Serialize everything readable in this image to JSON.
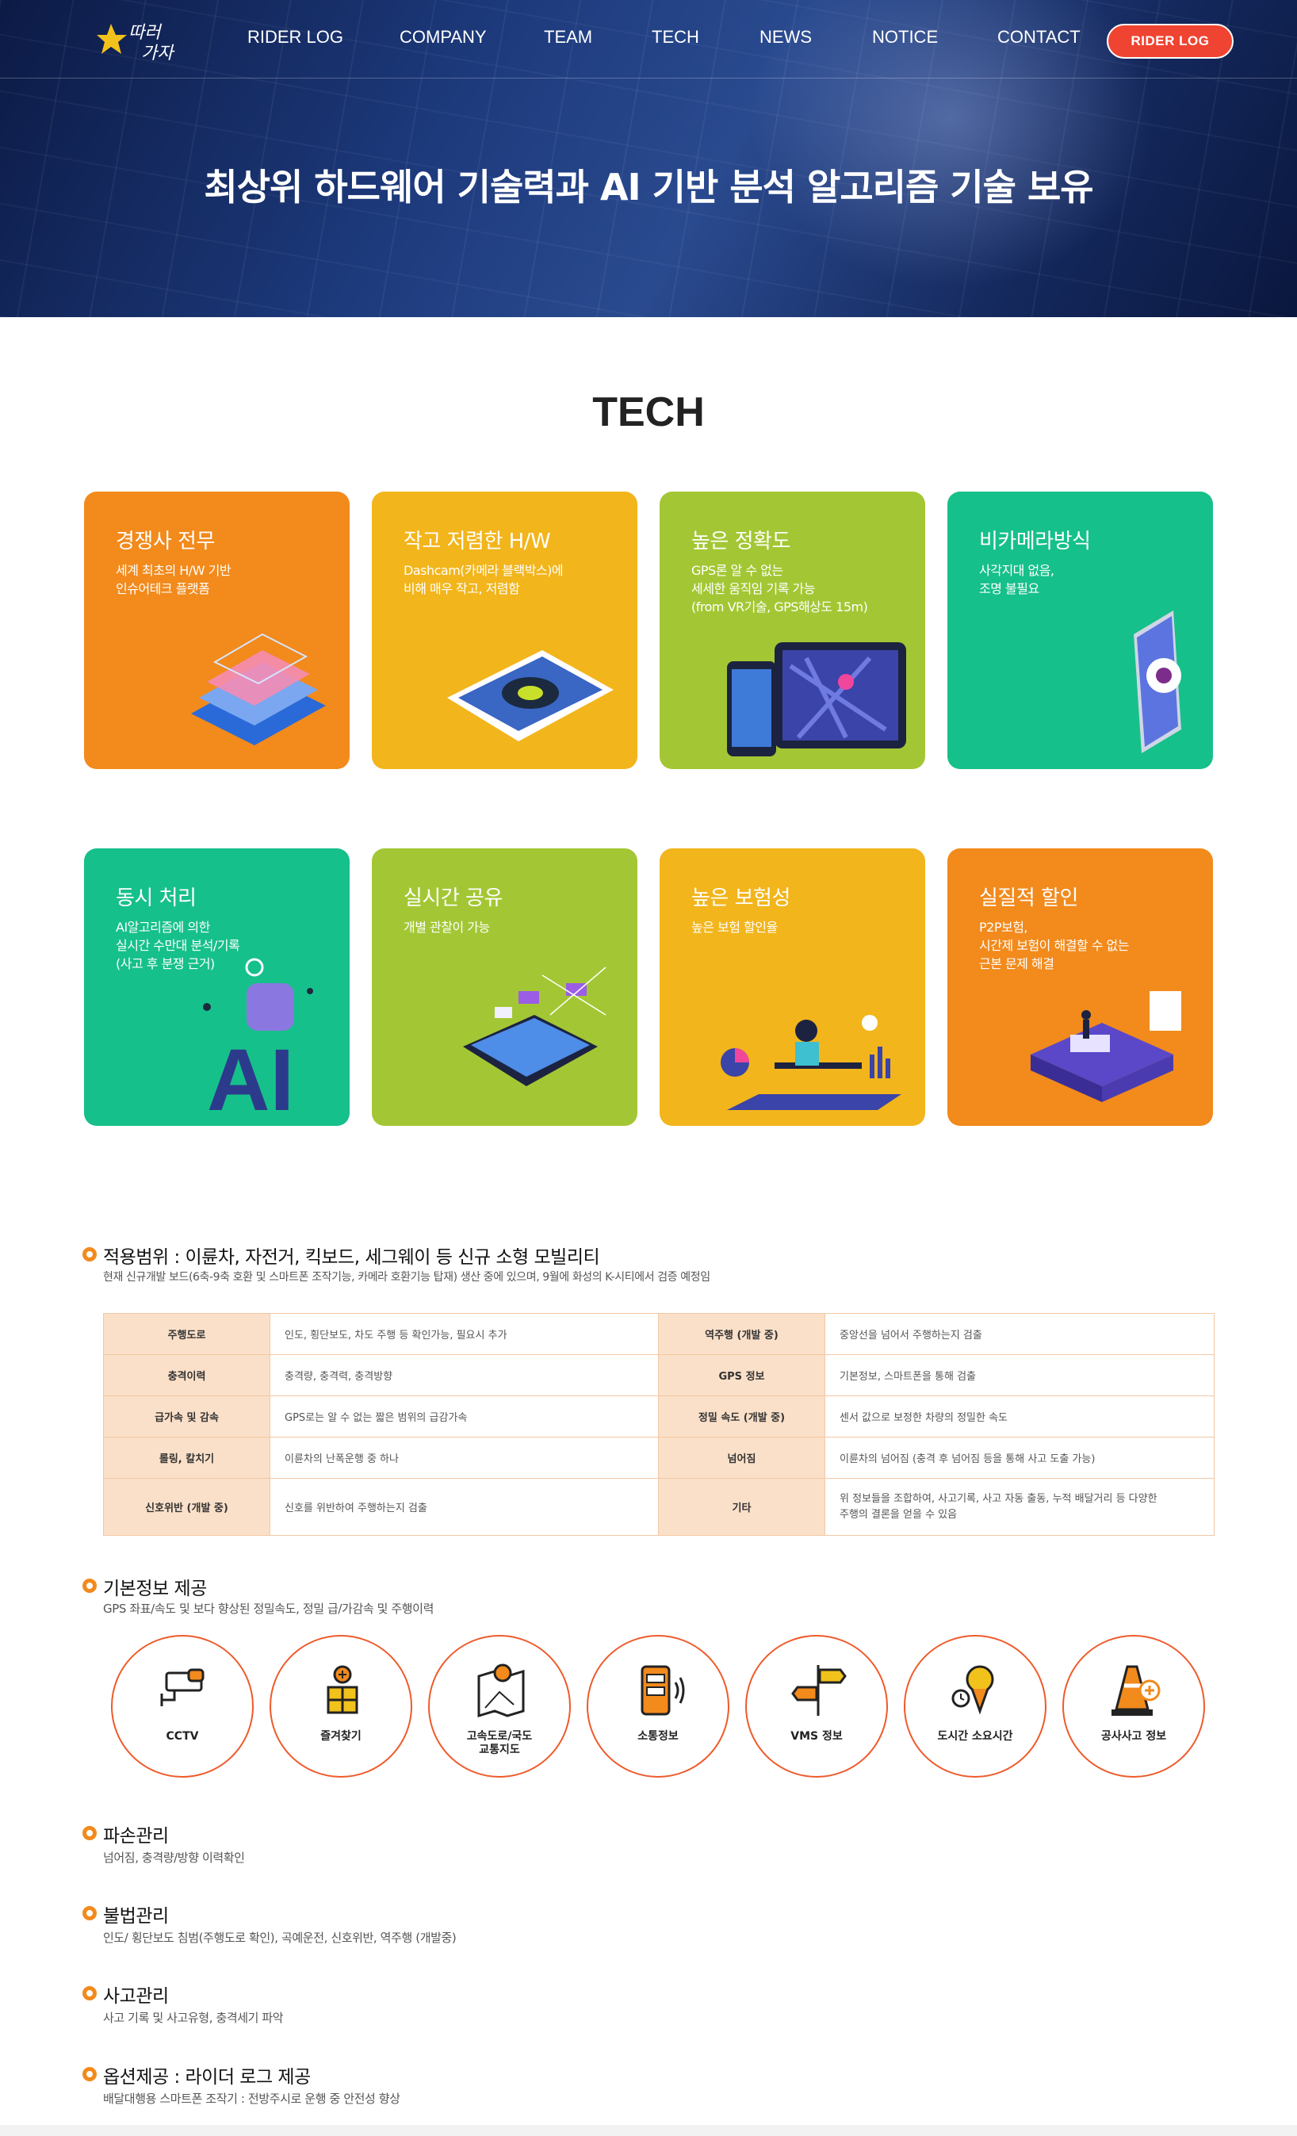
{
  "header": {
    "logo_text": "열따러 가자",
    "nav": [
      "RIDER LOG",
      "COMPANY",
      "TEAM",
      "TECH",
      "NEWS",
      "NOTICE",
      "CONTACT"
    ],
    "rider_button": "RIDER LOG"
  },
  "hero": {
    "title": "최상위 하드웨어 기술력과 AI 기반 분석 알고리즘 기술 보유"
  },
  "tech": {
    "title": "TECH",
    "cards": [
      {
        "title": "경쟁사 전무",
        "desc": "세계 최초의 H/W 기반\n인슈어테크 플랫폼",
        "color": "#f28a1c"
      },
      {
        "title": "작고 저렴한 H/W",
        "desc": "Dashcam(카메라 블랙박스)에\n비해 매우 작고, 저렴함",
        "color": "#f2b51c"
      },
      {
        "title": "높은 정확도",
        "desc": "GPS론 알 수 없는\n세세한 움직임 기록 가능\n(from VR기술, GPS해상도 15m)",
        "color": "#a3c734"
      },
      {
        "title": "비카메라방식",
        "desc": "사각지대 없음,\n조명 불필요",
        "color": "#16c08a"
      },
      {
        "title": "동시 처리",
        "desc": "AI알고리즘에 의한\n실시간 수만대 분석/기록\n(사고 후 분쟁 근거)",
        "color": "#16c08a"
      },
      {
        "title": "실시간 공유",
        "desc": "개별 관찰이 가능",
        "color": "#a3c734"
      },
      {
        "title": "높은 보험성",
        "desc": "높은 보험 할인율",
        "color": "#f2b51c"
      },
      {
        "title": "실질적 할인",
        "desc": "P2P보험,\n시간제 보험이 해결할 수 없는\n근본 문제 해결",
        "color": "#f28a1c"
      }
    ]
  },
  "scope": {
    "title": "적용범위 : 이륜차, 자전거, 킥보드, 세그웨이 등 신규 소형 모빌리티",
    "desc": "현재 신규개발 보드(6축-9축 호환 및 스마트폰 조작기능, 카메라 호환기능 탑재) 생산 중에 있으며, 9월에 화성의 K-시티에서 검증 예정임",
    "table": [
      [
        "주행도로",
        "인도, 횡단보도, 차도 주행 등 확인가능, 필요시 추가",
        "역주행 (개발 중)",
        "중앙선을 넘어서 주행하는지 검출"
      ],
      [
        "충격이력",
        "충격량, 충격력, 충격방향",
        "GPS 정보",
        "기본정보, 스마트폰을 통해 검출"
      ],
      [
        "급가속 및 감속",
        "GPS로는 알 수 없는 짧은 범위의 급감가속",
        "정밀 속도 (개발 중)",
        "센서 값으로 보정한 차량의 정밀한 속도"
      ],
      [
        "롤링, 칼치기",
        "이륜차의 난폭운행 중 하나",
        "넘어짐",
        "이륜차의 넘어짐 (충격 후 넘어짐 등을 통해 사고 도출 가능)"
      ],
      [
        "신호위반 (개발 중)",
        "신호를 위반하여 주행하는지 검출",
        "기타",
        "위 정보들을 조합하여, 사고기록, 사고 자동 출동, 누적 배달거리 등 다양한\n주행의 결론을 얻을 수 있음"
      ]
    ]
  },
  "basic": {
    "title": "기본정보 제공",
    "desc": "GPS 좌표/속도 및 보다 향상된 정밀속도, 정밀 급/가감속 및 주행이력",
    "items": [
      "CCTV",
      "즐겨찾기",
      "고속도로/국도\n교통지도",
      "소통정보",
      "VMS 정보",
      "도시간 소요시간",
      "공사사고 정보"
    ]
  },
  "damage": {
    "title": "파손관리",
    "desc": "넘어짐, 충격량/방향 이력확인"
  },
  "illegal": {
    "title": "불법관리",
    "desc": "인도/ 횡단보도 침범(주행도로 확인), 곡예운전, 신호위반, 역주행 (개발중)"
  },
  "accident": {
    "title": "사고관리",
    "desc": "사고 기록 및 사고유형, 충격세기 파악"
  },
  "option": {
    "title": "옵션제공 : 라이더 로그 제공",
    "desc": "배달대행용 스마트폰 조작기 : 전방주시로 운행 중 안전성 향상"
  }
}
